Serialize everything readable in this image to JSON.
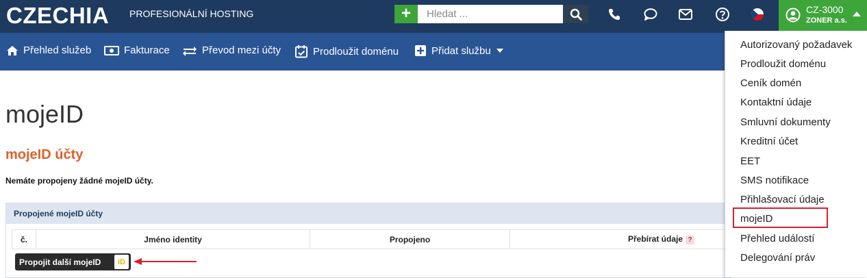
{
  "header": {
    "logo": "CZECHIA",
    "tagline": "PROFESIONÁLNÍ HOSTING",
    "add_label": "+",
    "search_placeholder": "Hledat ...",
    "user": {
      "code": "CZ-3000",
      "company": "ZONER a.s."
    }
  },
  "nav": {
    "items": [
      {
        "label": "Přehled služeb",
        "icon": "home-icon"
      },
      {
        "label": "Fakturace",
        "icon": "money-icon"
      },
      {
        "label": "Převod mezi účty",
        "icon": "transfer-icon"
      },
      {
        "label": "Prodloužit doménu",
        "icon": "calendar-check-icon"
      },
      {
        "label": "Přidat službu",
        "icon": "plus-square-icon"
      }
    ]
  },
  "main": {
    "title": "mojeID",
    "section_title": "mojeID účty",
    "notice": "Nemáte propojeny žádné mojeID účty.",
    "panel_title": "Propojené mojeID účty",
    "table": {
      "columns": [
        "č.",
        "Jméno identity",
        "Propojeno",
        "Přebírat údaje"
      ],
      "help_mark": "?"
    },
    "connect_button": "Propojit další mojeID",
    "mojeid_logo": "iD"
  },
  "dropdown": {
    "items": [
      "Autorizovaný požadavek",
      "Prodloužit doménu",
      "Ceník domén",
      "Kontaktní údaje",
      "Smluvní dokumenty",
      "Kreditní účet",
      "EET",
      "SMS notifikace",
      "Přihlašovací údaje",
      "mojeID",
      "Přehled událostí",
      "Delegování práv"
    ],
    "highlighted": "mojeID"
  },
  "colors": {
    "topbar": "#1e3a5f",
    "navbar": "#2a5595",
    "accent_green": "#3ea53b",
    "section_orange": "#e0602a",
    "highlight_red": "#d9202a"
  }
}
